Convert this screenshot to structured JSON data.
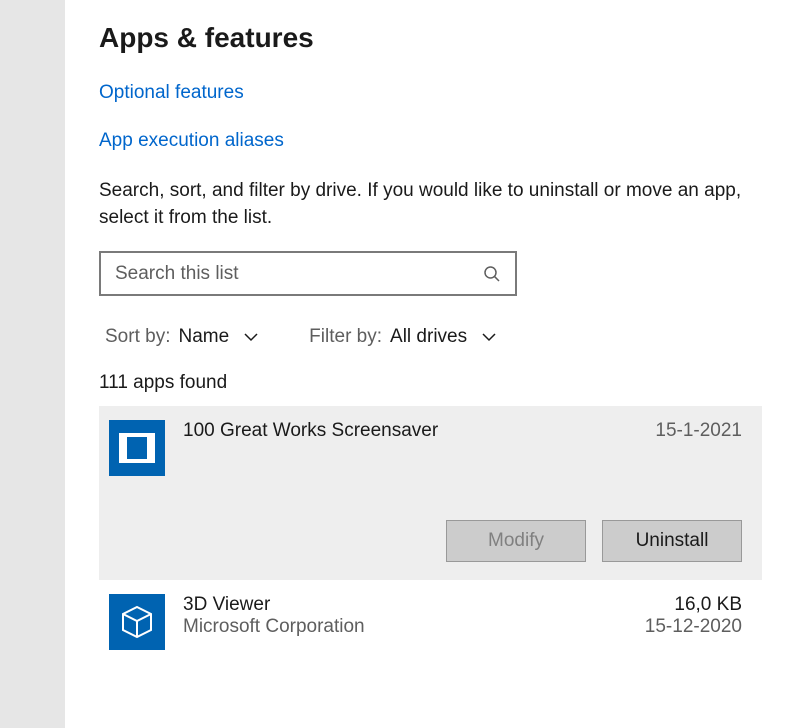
{
  "page_title": "Apps & features",
  "links": {
    "optional_features": "Optional features",
    "app_execution_aliases": "App execution aliases"
  },
  "help_text": "Search, sort, and filter by drive. If you would like to uninstall or move an app, select it from the list.",
  "search": {
    "placeholder": "Search this list"
  },
  "sort": {
    "label": "Sort by:",
    "value": "Name"
  },
  "filter": {
    "label": "Filter by:",
    "value": "All drives"
  },
  "count_text": "111 apps found",
  "actions": {
    "modify": "Modify",
    "uninstall": "Uninstall"
  },
  "apps": [
    {
      "name": "100 Great Works Screensaver",
      "publisher": "",
      "size": "",
      "date": "15-1-2021",
      "selected": true
    },
    {
      "name": "3D Viewer",
      "publisher": "Microsoft Corporation",
      "size": "16,0 KB",
      "date": "15-12-2020",
      "selected": false
    }
  ]
}
